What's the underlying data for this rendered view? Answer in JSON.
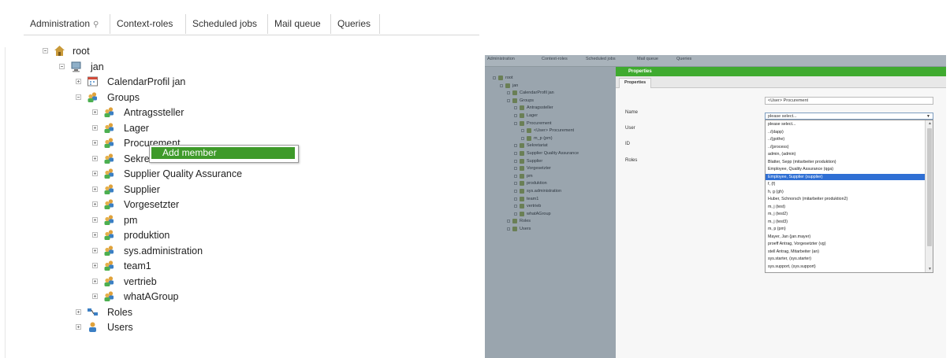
{
  "left": {
    "tabs": [
      "Administration",
      "Context-roles",
      "Scheduled jobs",
      "Mail queue",
      "Queries"
    ],
    "tree": [
      {
        "label": "root",
        "icon": "home-icon"
      },
      {
        "label": "jan",
        "icon": "computer-icon"
      },
      {
        "label": "CalendarProfil jan",
        "icon": "calendar-icon"
      },
      {
        "label": "Groups",
        "icon": "group-icon"
      },
      {
        "label": "Antragssteller",
        "icon": "group-icon"
      },
      {
        "label": "Lager",
        "icon": "group-icon"
      },
      {
        "label": "Procurement",
        "icon": "group-icon"
      },
      {
        "label": "Sekretariat",
        "icon": "group-icon"
      },
      {
        "label": "Supplier Quality Assurance",
        "icon": "group-icon"
      },
      {
        "label": "Supplier",
        "icon": "group-icon"
      },
      {
        "label": "Vorgesetzter",
        "icon": "group-icon"
      },
      {
        "label": "pm",
        "icon": "group-icon"
      },
      {
        "label": "produktion",
        "icon": "group-icon"
      },
      {
        "label": "sys.administration",
        "icon": "group-icon"
      },
      {
        "label": "team1",
        "icon": "group-icon"
      },
      {
        "label": "vertrieb",
        "icon": "group-icon"
      },
      {
        "label": "whatAGroup",
        "icon": "group-icon"
      },
      {
        "label": "Roles",
        "icon": "roles-icon"
      },
      {
        "label": "Users",
        "icon": "user-icon"
      }
    ],
    "context_menu": {
      "add_member": "Add member"
    }
  },
  "right": {
    "tabs": [
      "Administration",
      "Context-roles",
      "Scheduled jobs",
      "Mail queue",
      "Queries"
    ],
    "tree": [
      "root",
      "jan",
      "CalendarProfil jan",
      "Groups",
      "Antragssteller",
      "Lager",
      "Procurement",
      "<User> Procurement",
      "m_p (pm)",
      "Sekretariat",
      "Supplier Quality Assurance",
      "Supplier",
      "Vorgesetzter",
      "pm",
      "produktion",
      "sys.administration",
      "team1",
      "vertrieb",
      "whatAGroup",
      "Roles",
      "Users"
    ],
    "properties": {
      "title": "Properties",
      "tab": "Properties",
      "fields": {
        "name": "Name",
        "user": "User",
        "id": "ID",
        "roles": "Roles"
      },
      "name_value": "<User> Procurement",
      "user_select_value": "please select...",
      "options": [
        "please select...",
        "../(dapp)",
        "../(gothe)",
        "../(process)",
        "admin, (admin)",
        "Blatter, Sepp (mitarbeiter produktion)",
        "Employee, Quality Assurance (qga)",
        "Employee, Supplier (supplier)",
        "f, (f)",
        "h, g (gh)",
        "Huber, Schnorsch (mitarbeiter produktion2)",
        "m, j (test)",
        "m, j (test2)",
        "m, j (test3)",
        "m, p (pm)",
        "Mayer, Jan (jan.mayer)",
        "proeff Antrag, Vorgesetzter (vg)",
        "stell Antrag, Mitarbeiter (an)",
        "sys.starter, (sys.starter)",
        "sys.support, (sys.support)"
      ],
      "selected_option_index": 7
    }
  },
  "colors": {
    "accent_green": "#3e9a2a",
    "selection_blue": "#2f6fd4"
  }
}
